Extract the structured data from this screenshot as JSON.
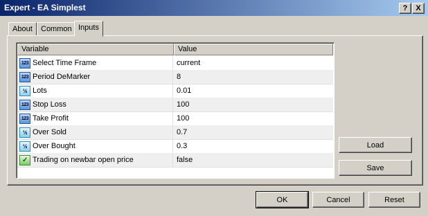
{
  "window": {
    "title": "Expert - EA Simplest",
    "help_label": "?",
    "close_label": "X"
  },
  "tabs": [
    {
      "label": "About"
    },
    {
      "label": "Common"
    },
    {
      "label": "Inputs"
    }
  ],
  "grid": {
    "headers": {
      "variable": "Variable",
      "value": "Value"
    },
    "rows": [
      {
        "icon": "int-icon",
        "glyph": "123",
        "variable": "Select Time Frame",
        "value": "current"
      },
      {
        "icon": "int-icon",
        "glyph": "123",
        "variable": "Period DeMarker",
        "value": "8"
      },
      {
        "icon": "double-icon",
        "glyph": "½",
        "variable": "Lots",
        "value": "0.01"
      },
      {
        "icon": "int-icon",
        "glyph": "123",
        "variable": "Stop Loss",
        "value": "100"
      },
      {
        "icon": "int-icon",
        "glyph": "123",
        "variable": "Take Profit",
        "value": "100"
      },
      {
        "icon": "double-icon",
        "glyph": "½",
        "variable": "Over Sold",
        "value": "0.7"
      },
      {
        "icon": "double-icon",
        "glyph": "½",
        "variable": "Over Bought",
        "value": "0.3"
      },
      {
        "icon": "bool-icon",
        "glyph": "✓",
        "variable": "Trading on newbar open price",
        "value": "false"
      }
    ]
  },
  "side_buttons": {
    "load": "Load",
    "save": "Save"
  },
  "bottom_buttons": {
    "ok": "OK",
    "cancel": "Cancel",
    "reset": "Reset"
  }
}
